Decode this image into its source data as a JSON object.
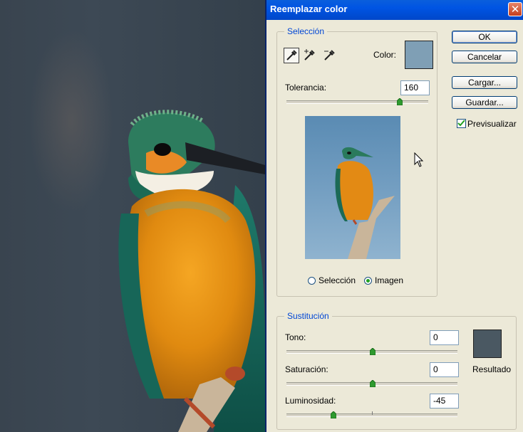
{
  "dialog": {
    "title": "Reemplazar color",
    "close_glyph": "✕",
    "selection_group": "Selección",
    "color_label": "Color:",
    "selected_color": "#7f9fb5",
    "tolerance_label": "Tolerancia:",
    "tolerance_value": "160",
    "tolerance_level": 160,
    "tolerance_max": 200,
    "view_options": [
      "Selección",
      "Imagen"
    ],
    "view_selected": "Imagen",
    "substitution_group": "Sustitución",
    "hue_label": "Tono:",
    "hue_value": "0",
    "saturation_label": "Saturación:",
    "saturation_value": "0",
    "lightness_label": "Luminosidad:",
    "lightness_value": "-45",
    "result_label": "Resultado",
    "result_color": "#4a5862"
  },
  "buttons": {
    "ok": "OK",
    "cancel": "Cancelar",
    "load": "Cargar...",
    "save": "Guardar..."
  },
  "preview_checkbox": {
    "label": "Previsualizar",
    "checked": true
  },
  "icons": [
    "eyedropper-icon",
    "eyedropper-plus-icon",
    "eyedropper-minus-icon",
    "close-icon",
    "mouse-cursor-icon"
  ]
}
